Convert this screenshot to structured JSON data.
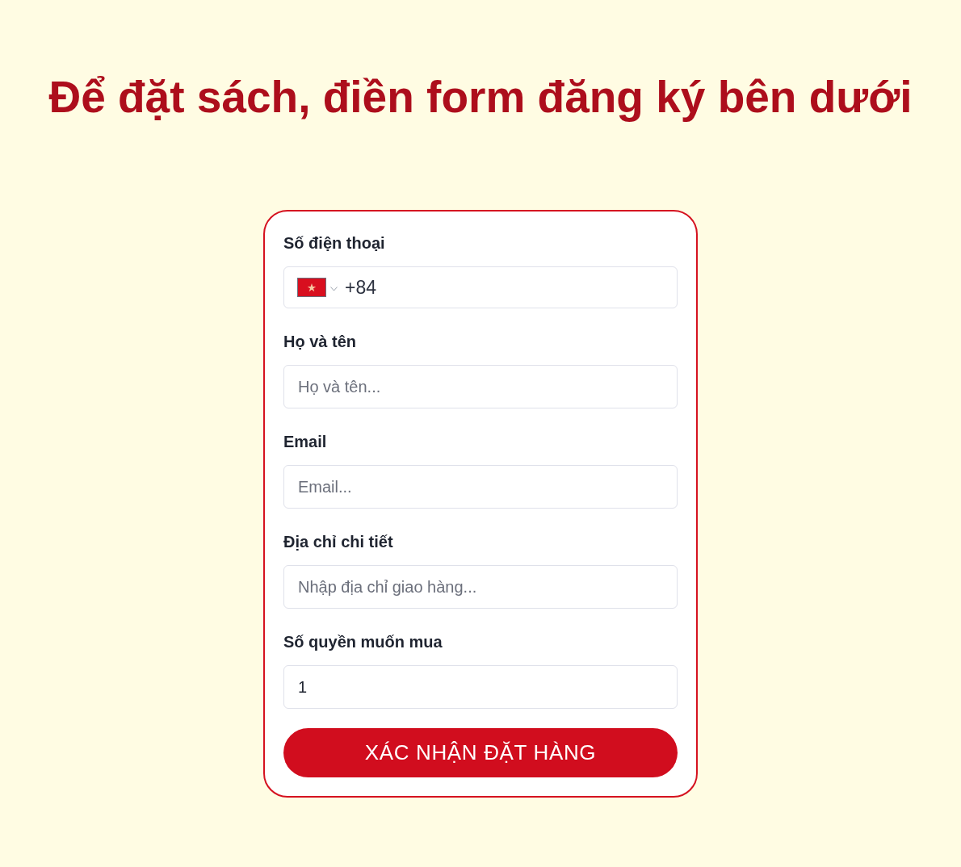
{
  "heading": "Để đặt sách, điền form đăng ký bên dưới",
  "form": {
    "fields": [
      {
        "kind": "phone",
        "label": "Số điện thoại",
        "value": "+84"
      },
      {
        "kind": "text",
        "label": "Họ và tên",
        "placeholder": "Họ và tên..."
      },
      {
        "kind": "text",
        "label": "Email",
        "placeholder": "Email..."
      },
      {
        "kind": "text",
        "label": "Địa chỉ chi tiết",
        "placeholder": "Nhập địa chỉ giao hàng..."
      },
      {
        "kind": "number",
        "label": "Số quyền muốn mua",
        "value": "1"
      }
    ],
    "submit": "XÁC NHẬN ĐẶT HÀNG"
  }
}
